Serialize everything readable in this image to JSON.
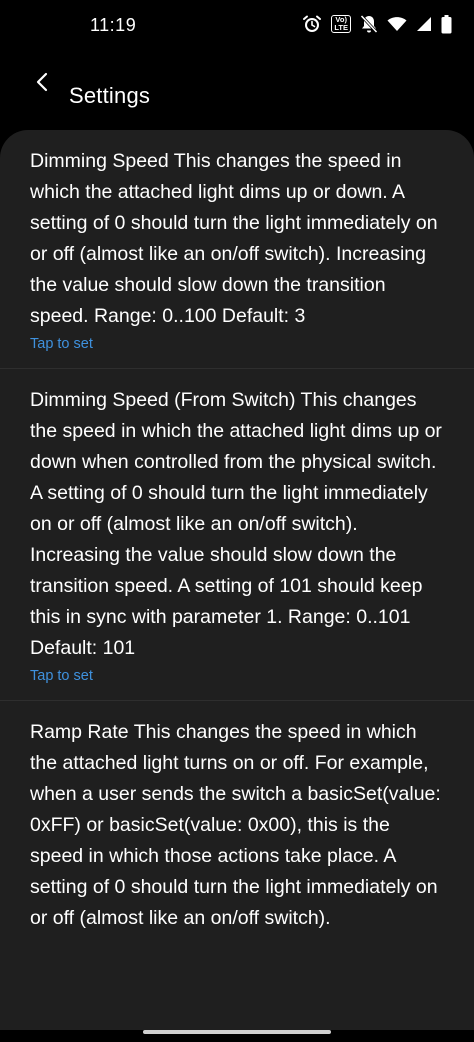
{
  "status_bar": {
    "time": "11:19",
    "icons": [
      "alarm-icon",
      "volte-icon",
      "notifications-off-icon",
      "wifi-icon",
      "signal-icon",
      "battery-icon"
    ],
    "volte_top": "Vo)",
    "volte_bottom": "LTE"
  },
  "app_bar": {
    "back_icon": "chevron-left-icon",
    "title": "Settings"
  },
  "settings": [
    {
      "description": "Dimming Speed This changes the speed in which the attached light dims up or down. A setting of 0 should turn the light immediately on or off (almost like an on/off switch). Increasing the value should slow down the transition speed. Range: 0..100 Default: 3",
      "action": "Tap to set"
    },
    {
      "description": "Dimming Speed (From Switch) This changes the speed in which the attached light dims up or down when controlled from the physical switch. A setting of 0 should turn the light immediately on or off (almost like an on/off switch). Increasing the value should slow down the transition speed. A setting of 101 should keep this in sync with parameter 1. Range: 0..101 Default: 101",
      "action": "Tap to set"
    },
    {
      "description": "Ramp Rate This changes the speed in which the attached light turns on or off. For example, when a user sends the switch a basicSet(value: 0xFF) or basicSet(value: 0x00), this is the speed in which those actions take place. A setting of 0 should turn the light immediately on or off (almost like an on/off switch).",
      "action": ""
    }
  ],
  "colors": {
    "background": "#000000",
    "card": "#1f1f1f",
    "accent": "#3f91dd",
    "text": "#ffffff"
  }
}
